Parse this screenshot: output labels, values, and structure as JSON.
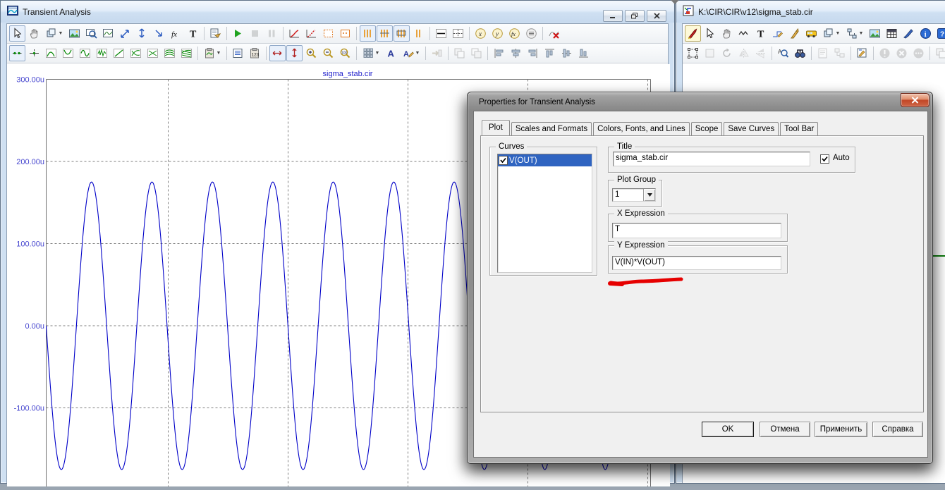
{
  "left_window": {
    "title": "Transient Analysis",
    "caption_buttons": [
      "minimize",
      "restore",
      "close"
    ],
    "toolbar1": [
      {
        "i": "cursor",
        "s": "sel"
      },
      {
        "i": "hand"
      },
      {
        "i": "cube",
        "drop": 1
      },
      {
        "i": "image"
      },
      {
        "i": "zoomreg"
      },
      {
        "i": "plotbox"
      },
      {
        "i": "scalexy"
      },
      {
        "i": "scaley"
      },
      {
        "i": "arrowdr"
      },
      {
        "i": "fx"
      },
      {
        "i": "textT"
      },
      {
        "sep": 1
      },
      {
        "i": "props"
      },
      {
        "sep": 1
      },
      {
        "i": "play"
      },
      {
        "i": "stop",
        "d": 1
      },
      {
        "i": "pause",
        "d": 1
      },
      {
        "sep": 1
      },
      {
        "i": "ramp1"
      },
      {
        "i": "ramp2"
      },
      {
        "i": "obox1"
      },
      {
        "i": "obox2"
      },
      {
        "sep": 1
      },
      {
        "i": "bars1",
        "s": "sel"
      },
      {
        "i": "bars2",
        "s": "sel"
      },
      {
        "i": "bars3",
        "s": "sel"
      },
      {
        "i": "bars4"
      },
      {
        "sep": 1
      },
      {
        "i": "hline"
      },
      {
        "i": "crosshair"
      },
      {
        "sep": 1
      },
      {
        "i": "circx"
      },
      {
        "i": "circy"
      },
      {
        "i": "circfx"
      },
      {
        "i": "circeq"
      },
      {
        "sep": 1
      },
      {
        "i": "delcurve"
      }
    ],
    "toolbar2": [
      {
        "i": "wpt1",
        "s": "sel"
      },
      {
        "i": "wpt2"
      },
      {
        "i": "gpeak"
      },
      {
        "i": "gvalley"
      },
      {
        "i": "gsine"
      },
      {
        "i": "gnoise"
      },
      {
        "i": "gdiag"
      },
      {
        "i": "gcross"
      },
      {
        "i": "gcrossx"
      },
      {
        "i": "gmulti"
      },
      {
        "i": "gmulti2"
      },
      {
        "sep": 1
      },
      {
        "i": "clipwave",
        "drop": 1
      },
      {
        "sep": 1
      },
      {
        "i": "bluelist"
      },
      {
        "i": "clip123"
      },
      {
        "sep": 1
      },
      {
        "i": "scxbox",
        "s": "sel"
      },
      {
        "i": "scybox",
        "s": "sel"
      },
      {
        "i": "zoomin"
      },
      {
        "i": "zoomout"
      },
      {
        "i": "zoom100"
      },
      {
        "sep": 1
      },
      {
        "i": "grid",
        "drop": 1
      },
      {
        "i": "fontA"
      },
      {
        "i": "fontAp",
        "drop": 1
      },
      {
        "sep": 1
      },
      {
        "i": "goarrow",
        "d": 1
      },
      {
        "sep": 1
      },
      {
        "i": "casc1",
        "d": 1
      },
      {
        "i": "casc2",
        "d": 1
      },
      {
        "sep": 1
      },
      {
        "i": "alignl"
      },
      {
        "i": "alignc"
      },
      {
        "i": "alignr"
      },
      {
        "i": "alignt"
      },
      {
        "i": "alignm"
      },
      {
        "i": "alignb"
      }
    ]
  },
  "right_window": {
    "title": "K:\\CIR\\CIR\\v12\\sigma_stab.cir",
    "toolbar1": [
      {
        "i": "penred",
        "s": "selY"
      },
      {
        "i": "cursor"
      },
      {
        "i": "hand"
      },
      {
        "i": "zigzag"
      },
      {
        "i": "textT"
      },
      {
        "i": "penwire"
      },
      {
        "i": "pend"
      },
      {
        "i": "bus"
      },
      {
        "i": "cube",
        "drop": 1
      },
      {
        "i": "flow",
        "drop": 1
      },
      {
        "i": "image"
      },
      {
        "i": "tableD"
      },
      {
        "i": "brush"
      },
      {
        "i": "info"
      },
      {
        "i": "helpq"
      }
    ],
    "toolbar2": [
      {
        "i": "selbox"
      },
      {
        "i": "boxg",
        "d": 1
      },
      {
        "i": "rotate",
        "d": 1
      },
      {
        "i": "fliph",
        "d": 1
      },
      {
        "i": "flipv",
        "d": 1
      },
      {
        "sep": 1
      },
      {
        "i": "findA"
      },
      {
        "i": "binoc"
      },
      {
        "sep": 1
      },
      {
        "i": "noteg",
        "d": 1
      },
      {
        "i": "boxes",
        "d": 1
      },
      {
        "sep": 1
      },
      {
        "i": "penbox"
      },
      {
        "sep": 1
      },
      {
        "i": "cexcl",
        "d": 1
      },
      {
        "i": "ccross",
        "d": 1
      },
      {
        "i": "cdots",
        "d": 1
      },
      {
        "sep": 1
      },
      {
        "i": "casc1",
        "d": 1
      },
      {
        "i": "casc2",
        "d": 1
      }
    ]
  },
  "chart_data": {
    "type": "line",
    "title": "sigma_stab.cir",
    "series": [
      {
        "name": "V(OUT)",
        "color": "#0000c8"
      }
    ],
    "y_unit": "u",
    "y_tick_labels": [
      "300.00u",
      "200.00u",
      "100.00u",
      "0.00u",
      "-100.00u"
    ],
    "y_tick_values_u": [
      300,
      200,
      100,
      0,
      -100
    ],
    "amplitude_u": 175,
    "offset_u": 0,
    "cycles_visible": 10,
    "waveform": "sine_starting_at_zero_going_negative",
    "x_gridline_count": 5,
    "grid": "dashed",
    "x_axis_labels_visible": false
  },
  "dialog": {
    "title": "Properties for Transient Analysis",
    "close_label": "X",
    "tabs": [
      {
        "label": "Plot",
        "active": true
      },
      {
        "label": "Scales and Formats"
      },
      {
        "label": "Colors, Fonts, and Lines"
      },
      {
        "label": "Scope"
      },
      {
        "label": "Save Curves"
      },
      {
        "label": "Tool Bar"
      }
    ],
    "curves_group": {
      "label": "Curves",
      "items": [
        {
          "label": "V(OUT)",
          "checked": true,
          "selected": true
        }
      ]
    },
    "title_group": {
      "label": "Title",
      "value": "sigma_stab.cir",
      "auto_label": "Auto",
      "auto_checked": true
    },
    "plot_group": {
      "label": "Plot Group",
      "value": "1"
    },
    "x_expression": {
      "label": "X Expression",
      "value": "T"
    },
    "y_expression": {
      "label": "Y Expression",
      "value": "V(IN)*V(OUT)"
    },
    "buttons": [
      {
        "label": "OK",
        "default": true
      },
      {
        "label": "Отмена"
      },
      {
        "label": "Применить"
      },
      {
        "label": "Справка"
      }
    ],
    "annotation": "red-marker-under-y-expression"
  }
}
